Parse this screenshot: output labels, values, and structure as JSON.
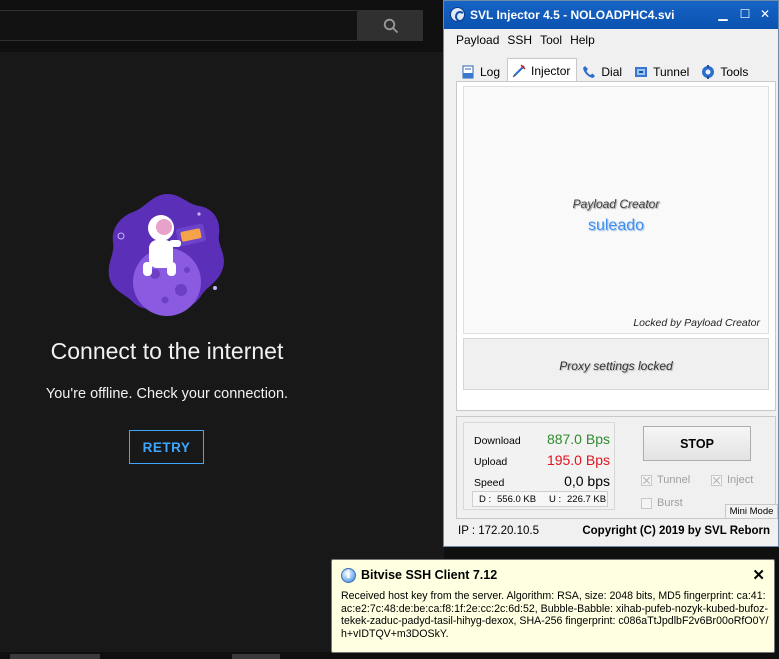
{
  "browser": {
    "offline_title": "Connect to the internet",
    "offline_subtitle": "You're offline. Check your connection.",
    "retry_label": "RETRY"
  },
  "injector": {
    "window_title": "SVL Injector 4.5 - NOLOADPHC4.svi",
    "menu": [
      "Payload",
      "SSH",
      "Tool",
      "Help"
    ],
    "tabs": [
      {
        "label": "Log",
        "icon": "log-icon"
      },
      {
        "label": "Injector",
        "icon": "syringe-icon"
      },
      {
        "label": "Dial",
        "icon": "phone-icon"
      },
      {
        "label": "Tunnel",
        "icon": "tunnel-icon"
      },
      {
        "label": "Tools",
        "icon": "tools-icon"
      }
    ],
    "active_tab": "Injector",
    "payload_creator_label": "Payload Creator",
    "payload_creator_name": "suleado",
    "locked_text": "Locked by Payload Creator",
    "proxy_text": "Proxy settings locked",
    "stats": {
      "download_label": "Download",
      "download_value": "887.0 Bps",
      "upload_label": "Upload",
      "upload_value": "195.0 Bps",
      "speed_label": "Speed",
      "speed_value": "0,0 bps",
      "d_label": "D :",
      "d_value": "556.0 KB",
      "u_label": "U :",
      "u_value": "226.7 KB"
    },
    "stop_label": "STOP",
    "checkboxes": {
      "tunnel": {
        "label": "Tunnel",
        "checked": true
      },
      "inject": {
        "label": "Inject",
        "checked": true
      },
      "burst": {
        "label": "Burst",
        "checked": false
      }
    },
    "mini_mode_label": "Mini Mode",
    "ip_text": "IP : 172.20.10.5",
    "copyright": "Copyright (C) 2019 by SVL Reborn",
    "colors": {
      "download": "#2e8b2e",
      "upload": "#e0141e",
      "speed": "#000000"
    }
  },
  "notification": {
    "title": "Bitvise SSH Client 7.12",
    "close": "✕",
    "body": "Received host key from the server. Algorithm: RSA, size: 2048 bits, MD5 fingerprint: ca:41:ac:e2:7c:48:de:be:ca:f8:1f:2e:cc:2c:6d:52, Bubble-Babble: xihab-pufeb-nozyk-kubed-bufoz-tekek-zaduc-padyd-tasil-hihyg-dexox, SHA-256 fingerprint: c086aTtJpdlbF2v6Br00oRfO0Y/h+vIDTQV+m3DOSkY."
  }
}
